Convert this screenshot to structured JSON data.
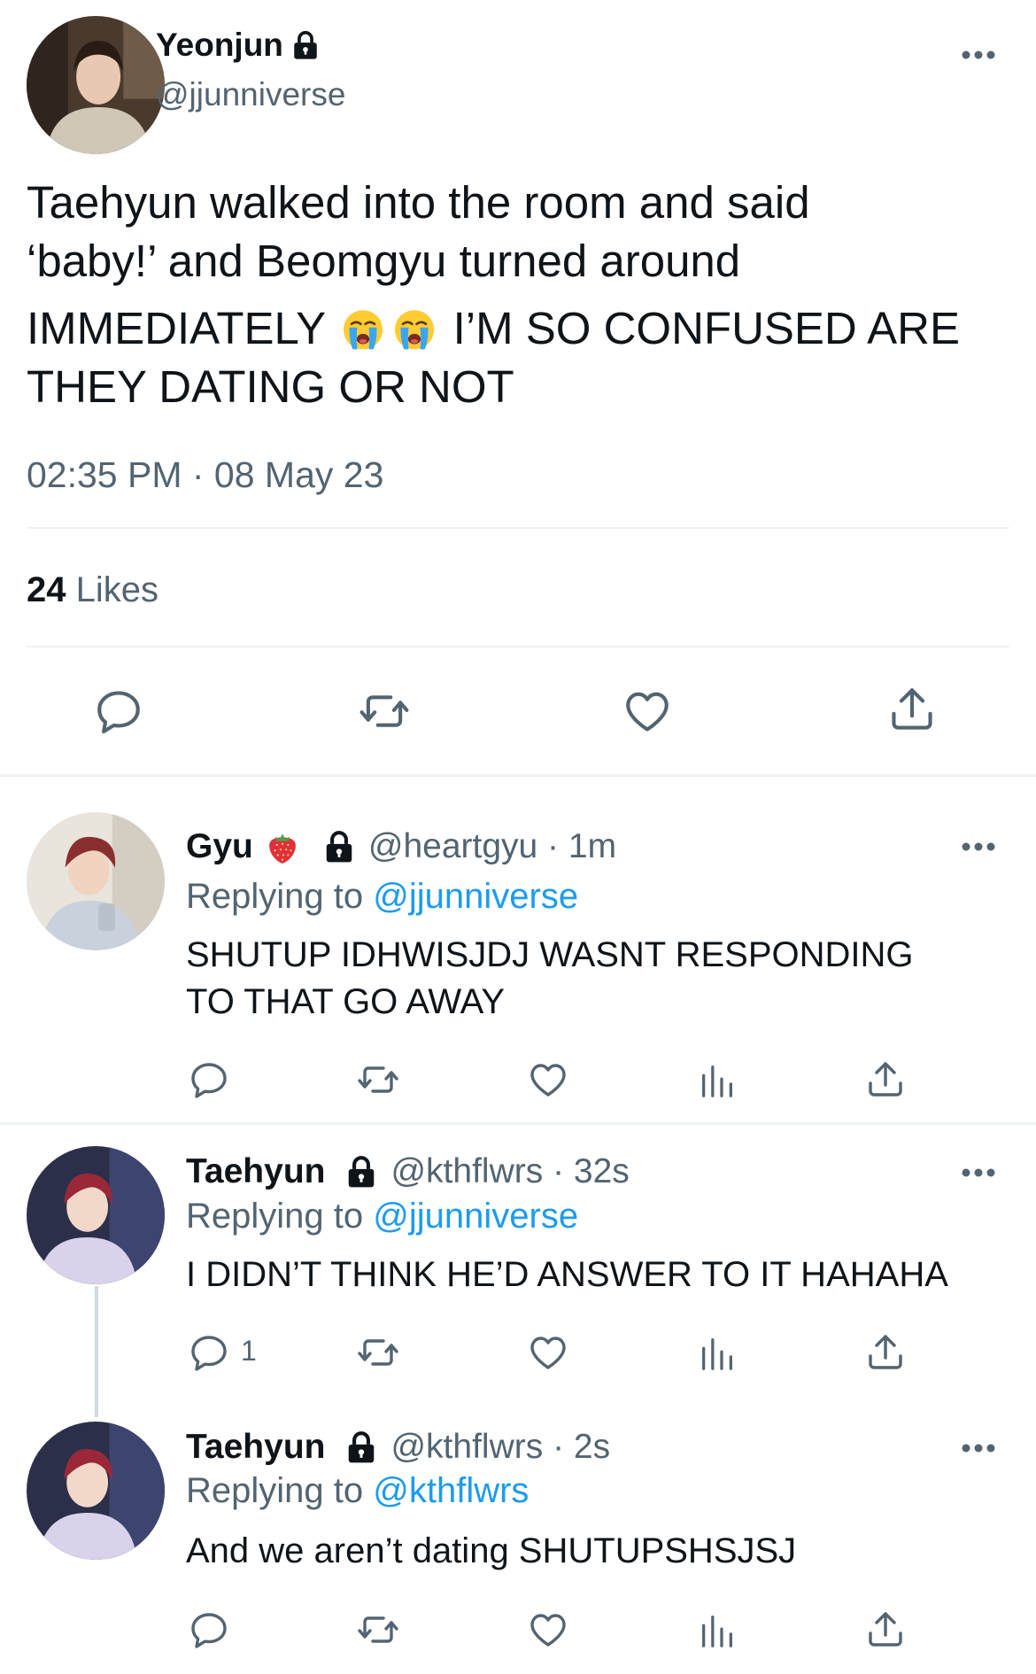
{
  "colors": {
    "text": "#0f1419",
    "secondary": "#536471",
    "link": "#1d9bf0",
    "divider": "#eff3f4"
  },
  "main_tweet": {
    "display_name": "Yeonjun",
    "handle": "@jjunniverse",
    "text_line1": "Taehyun walked into the room and said",
    "text_line2": "‘baby!’ and Beomgyu turned around",
    "text_line3_before": "IMMEDIATELY",
    "text_line3_emoji": [
      "loudly-crying-face",
      "loudly-crying-face"
    ],
    "text_line3_after": "I’M SO CONFUSED ARE",
    "text_line4": "THEY DATING OR NOT",
    "timestamp": "02:35 PM · 08 May 23",
    "likes_count": "24",
    "likes_label": "Likes",
    "actions": [
      "reply-icon",
      "retweet-icon",
      "like-icon",
      "share-icon"
    ]
  },
  "replies": [
    {
      "display_name": "Gyu",
      "emoji": "strawberry",
      "handle_time": "@heartgyu · 1m",
      "replying_label": "Replying to",
      "replying_to": "@jjunniverse",
      "text_line1": "SHUTUP IDHWISJDJ WASNT RESPONDING",
      "text_line2": "TO THAT GO AWAY"
    },
    {
      "display_name": "Taehyun",
      "handle_time": "@kthflwrs · 32s",
      "replying_label": "Replying to",
      "replying_to": "@jjunniverse",
      "text_line1": "I DIDN’T THINK HE’D ANSWER TO IT HAHAHA",
      "reply_count": "1"
    },
    {
      "display_name": "Taehyun",
      "handle_time": "@kthflwrs · 2s",
      "replying_label": "Replying to",
      "replying_to": "@kthflwrs",
      "text_line1": "And we aren’t dating SHUTUPSHSJSJ"
    }
  ]
}
